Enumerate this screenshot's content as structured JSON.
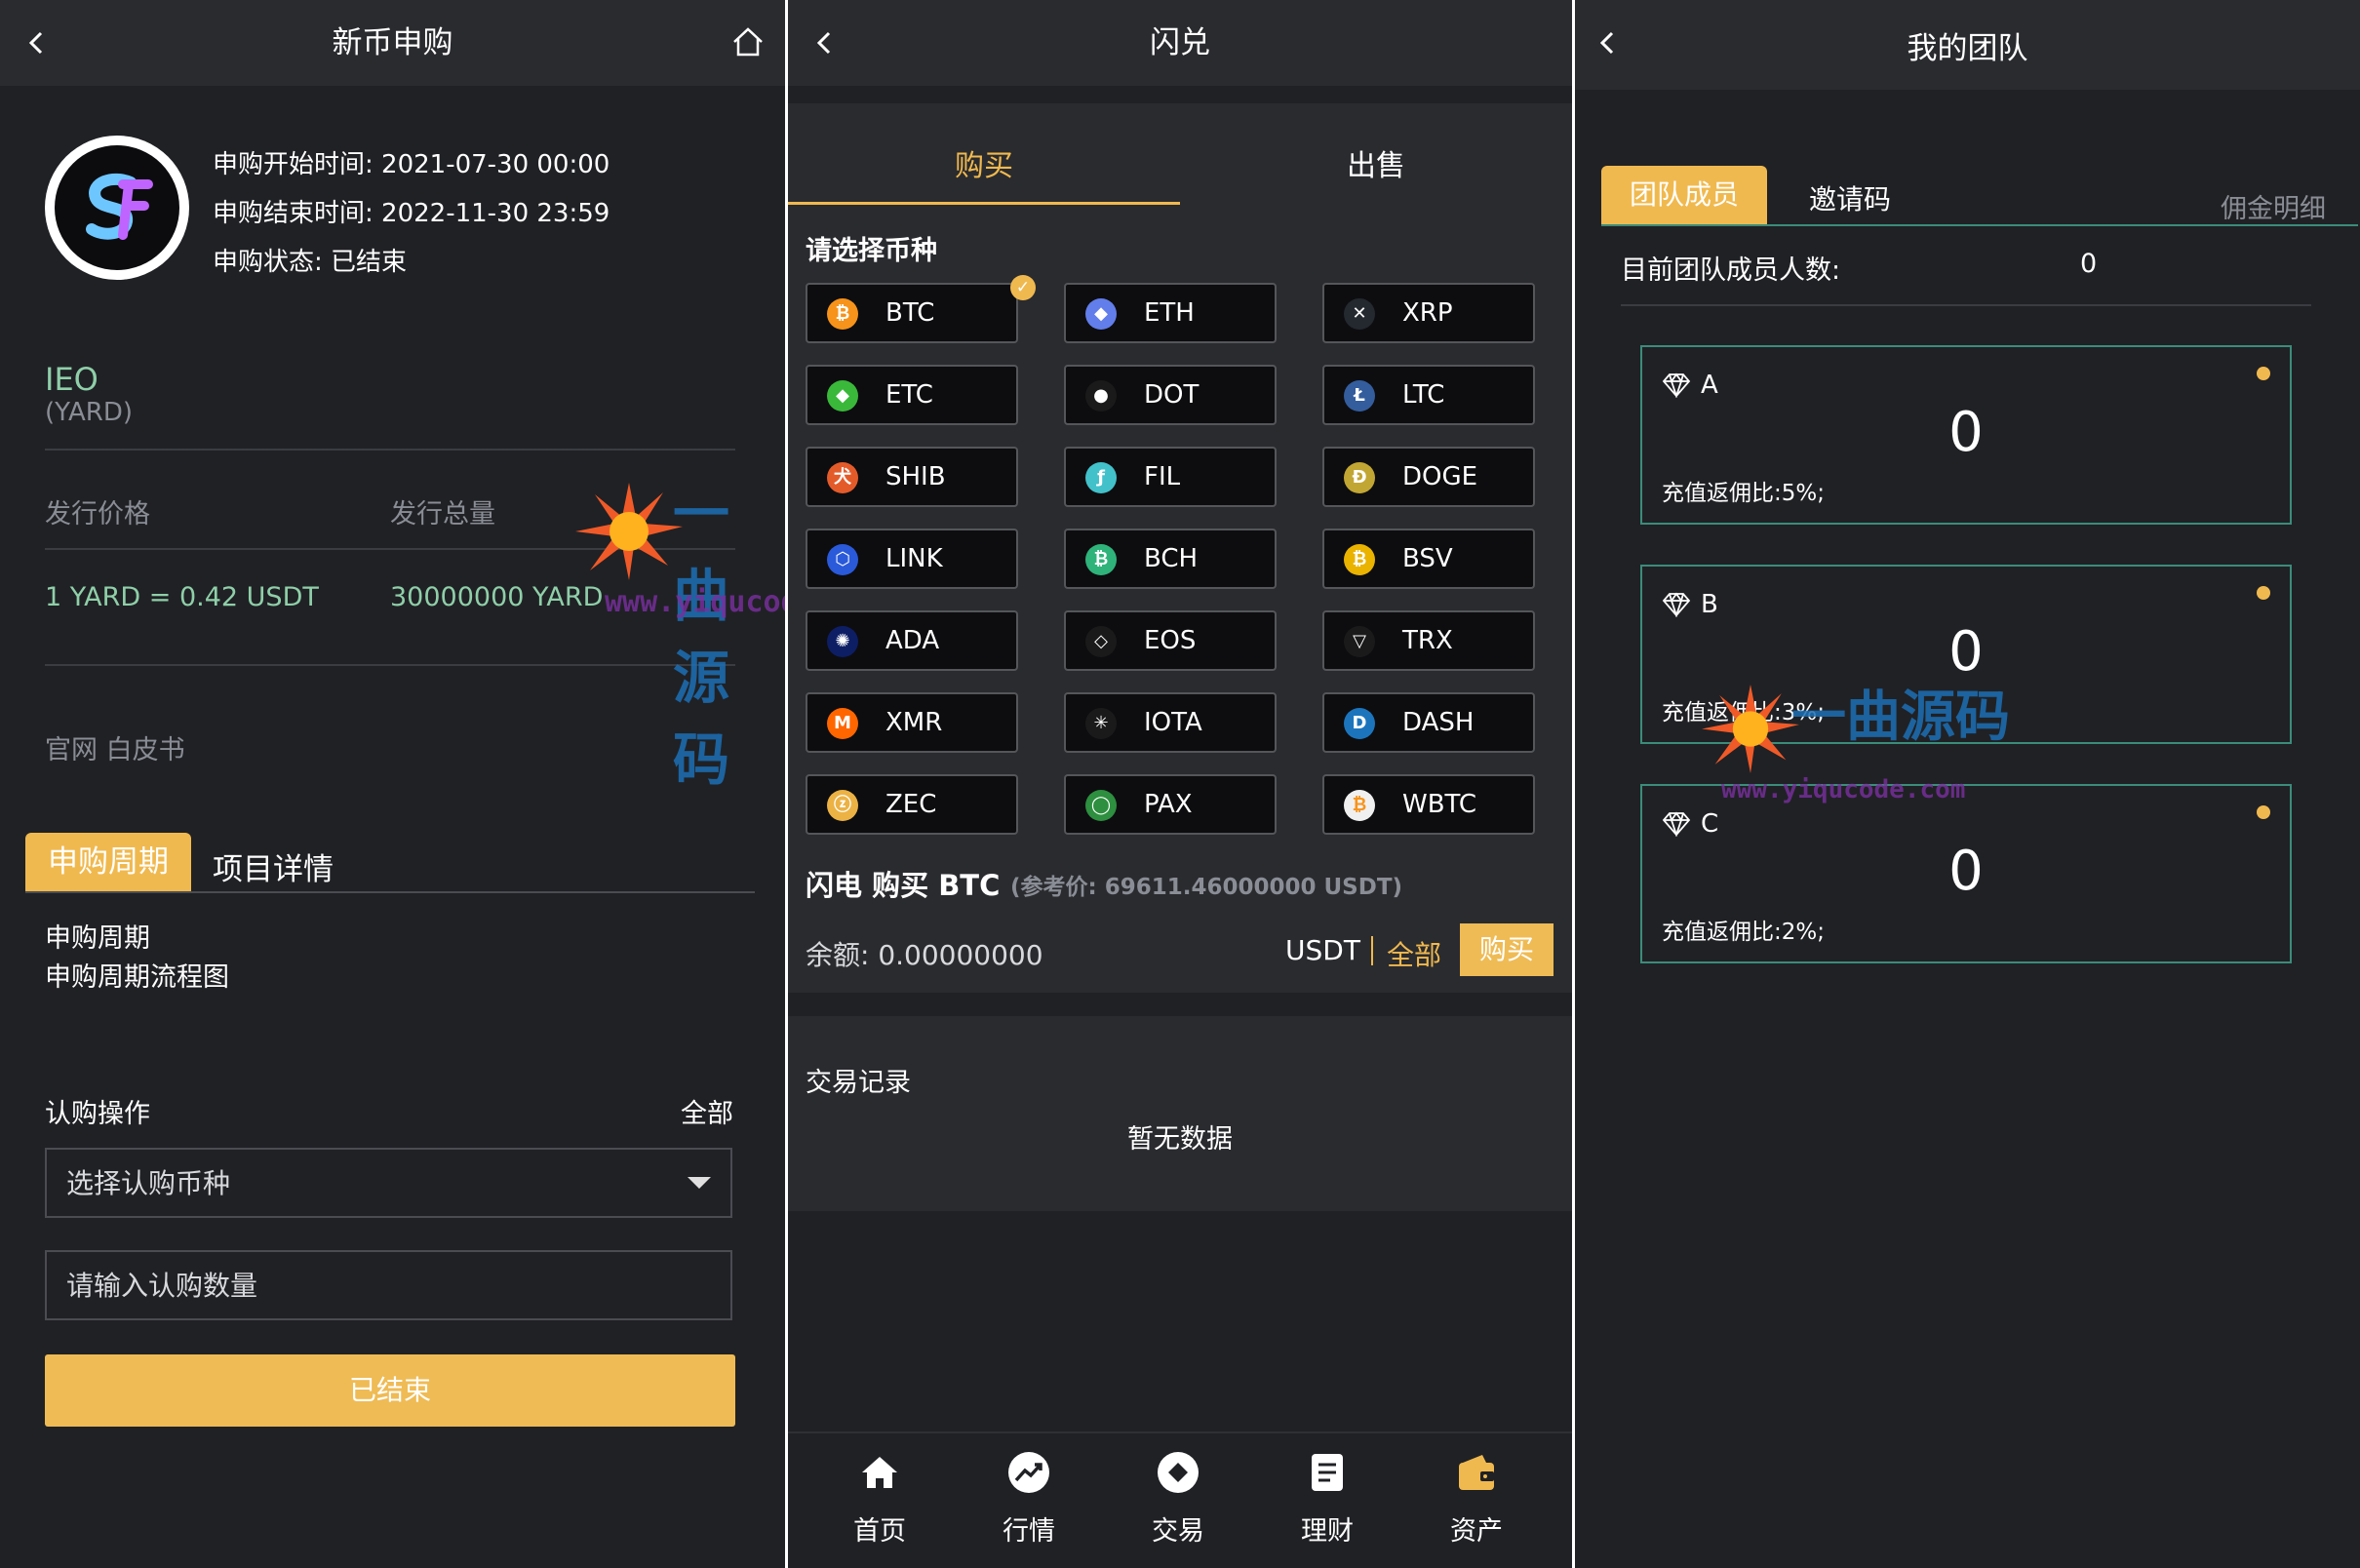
{
  "ieo": {
    "title": "新币申购",
    "start_time": "申购开始时间: 2021-07-30 00:00",
    "end_time": "申购结束时间: 2022-11-30 23:59",
    "status": "申购状态: 已结束",
    "type": "IEO",
    "symbol": "(YARD)",
    "price_label": "发行价格",
    "total_label": "发行总量",
    "price_value": "1 YARD = 0.42 USDT",
    "total_value": "30000000 YARD",
    "links": "官网 白皮书",
    "tabs": [
      "申购周期",
      "项目详情"
    ],
    "cycle_title": "申购周期",
    "cycle_chart": "申购周期流程图",
    "op_label": "认购操作",
    "op_all": "全部",
    "select_placeholder": "选择认购币种",
    "amount_placeholder": "请输入认购数量",
    "button": "已结束"
  },
  "exchange": {
    "title": "闪兑",
    "tabs": [
      "购买",
      "出售"
    ],
    "choose_label": "请选择币种",
    "coins": [
      {
        "name": "BTC",
        "color": "#f7931a",
        "glyph": "₿"
      },
      {
        "name": "ETH",
        "color": "#627eea",
        "glyph": "◆"
      },
      {
        "name": "XRP",
        "color": "#23292f",
        "glyph": "✕"
      },
      {
        "name": "ETC",
        "color": "#3ab83a",
        "glyph": "◆"
      },
      {
        "name": "DOT",
        "color": "#1a1a1a",
        "glyph": "●"
      },
      {
        "name": "LTC",
        "color": "#345d9d",
        "glyph": "Ł"
      },
      {
        "name": "SHIB",
        "color": "#e45b2a",
        "glyph": "犬"
      },
      {
        "name": "FIL",
        "color": "#42c1ca",
        "glyph": "ƒ"
      },
      {
        "name": "DOGE",
        "color": "#c2a633",
        "glyph": "Ð"
      },
      {
        "name": "LINK",
        "color": "#2a5ada",
        "glyph": "⬡"
      },
      {
        "name": "BCH",
        "color": "#2fb37a",
        "glyph": "₿"
      },
      {
        "name": "BSV",
        "color": "#eab300",
        "glyph": "₿"
      },
      {
        "name": "ADA",
        "color": "#0d1e64",
        "glyph": "✺"
      },
      {
        "name": "EOS",
        "color": "#1a1a1a",
        "glyph": "◇"
      },
      {
        "name": "TRX",
        "color": "#1a1a1a",
        "glyph": "▽"
      },
      {
        "name": "XMR",
        "color": "#ff6600",
        "glyph": "M"
      },
      {
        "name": "IOTA",
        "color": "#1a1a1a",
        "glyph": "✳"
      },
      {
        "name": "DASH",
        "color": "#1c75bc",
        "glyph": "D"
      },
      {
        "name": "ZEC",
        "color": "#ecb244",
        "glyph": "ⓩ"
      },
      {
        "name": "PAX",
        "color": "#2d8f3f",
        "glyph": "◯"
      },
      {
        "name": "WBTC",
        "color": "#f0f0f0",
        "glyph": "₿"
      }
    ],
    "buy_title": "闪电 购买 BTC",
    "ref_price": "(参考价: 69611.46000000 USDT)",
    "balance": "余额: 0.00000000",
    "unit": "USDT",
    "all": "全部",
    "buy_button": "购买",
    "records_title": "交易记录",
    "no_data": "暂无数据",
    "tabbar": [
      "首页",
      "行情",
      "交易",
      "理财",
      "资产"
    ]
  },
  "team": {
    "title": "我的团队",
    "tabs": [
      "团队成员",
      "邀请码"
    ],
    "commission": "佣金明细",
    "count_label": "目前团队成员人数:",
    "count_value": "0",
    "levels": [
      {
        "name": "A",
        "value": "0",
        "rate": "充值返佣比:5%;"
      },
      {
        "name": "B",
        "value": "0",
        "rate": "充值返佣比:3%;"
      },
      {
        "name": "C",
        "value": "0",
        "rate": "充值返佣比:2%;"
      }
    ]
  },
  "watermark": {
    "text": "www.yiqucode.com",
    "brand": "一曲源码"
  },
  "colors": {
    "background": "#202125",
    "accent": "#f0b94f",
    "green_text": "#8fcfa9",
    "card_border": "#3b8c7a"
  }
}
